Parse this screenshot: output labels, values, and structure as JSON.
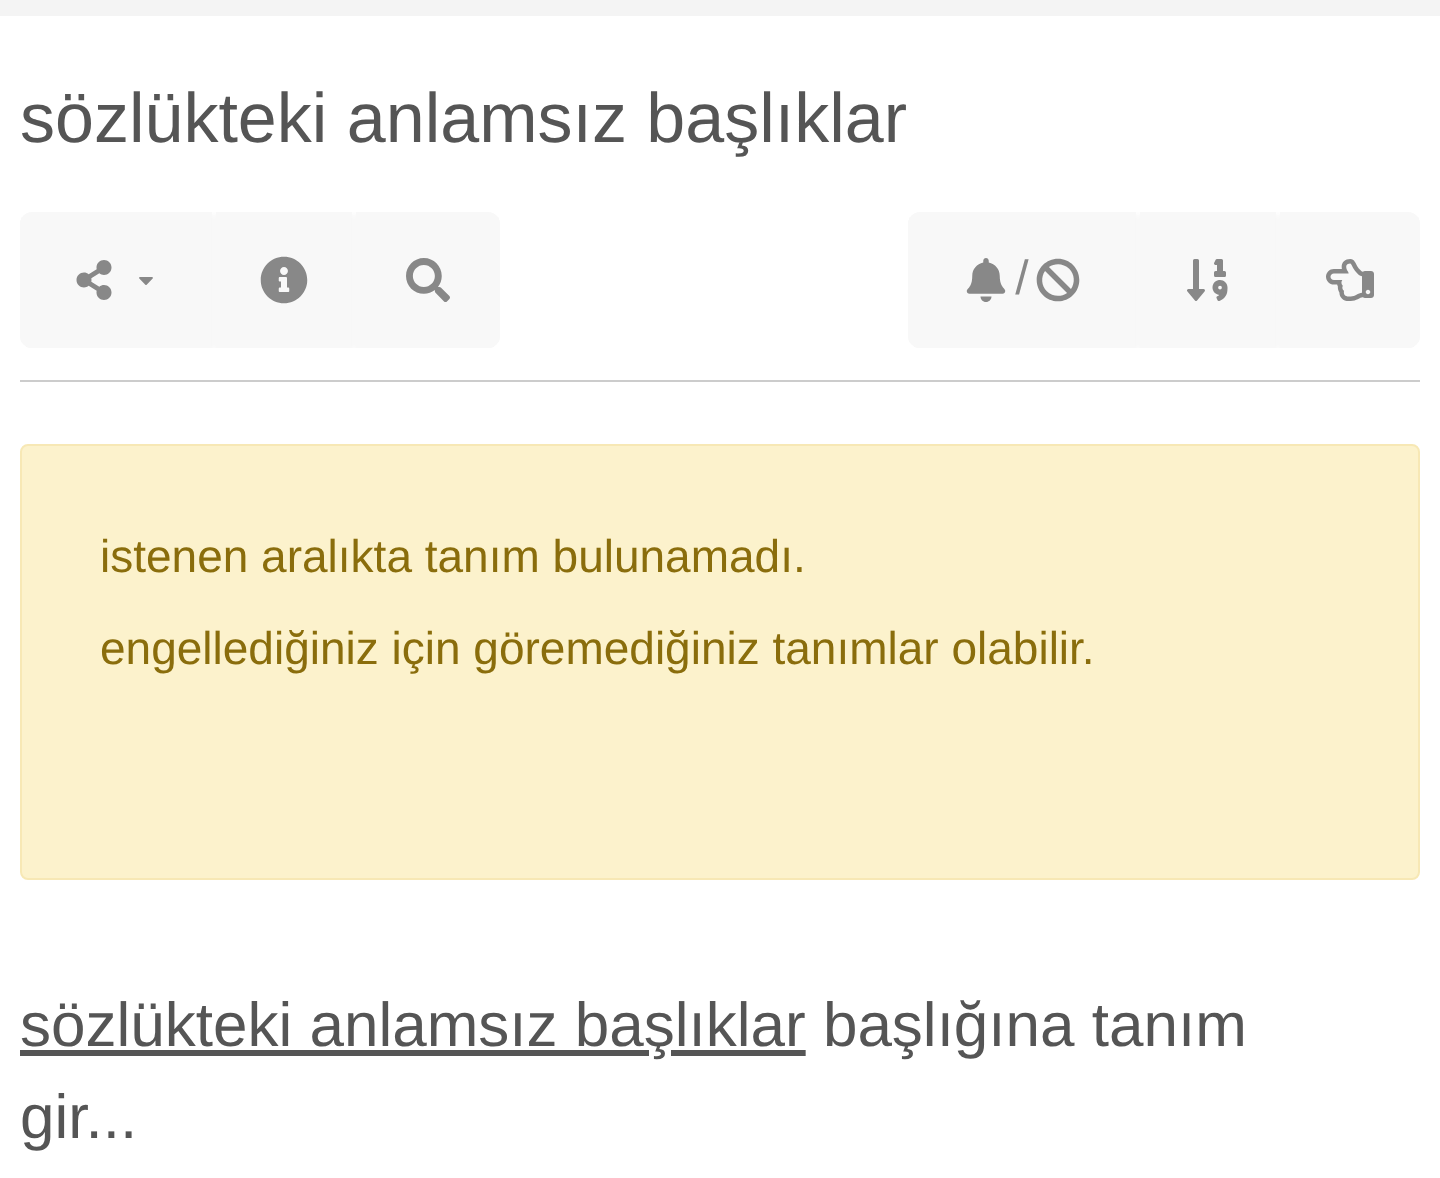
{
  "title": "sözlükteki anlamsız başlıklar",
  "toolbar": {
    "bell_block_separator": "/"
  },
  "alert": {
    "lines": [
      "istenen aralıkta tanım bulunamadı.",
      "engellediğiniz için göremediğiniz tanımlar olabilir."
    ]
  },
  "entry_prompt": {
    "link": "sözlükteki anlamsız başlıklar",
    "text": "başlığına tanım gir..."
  }
}
